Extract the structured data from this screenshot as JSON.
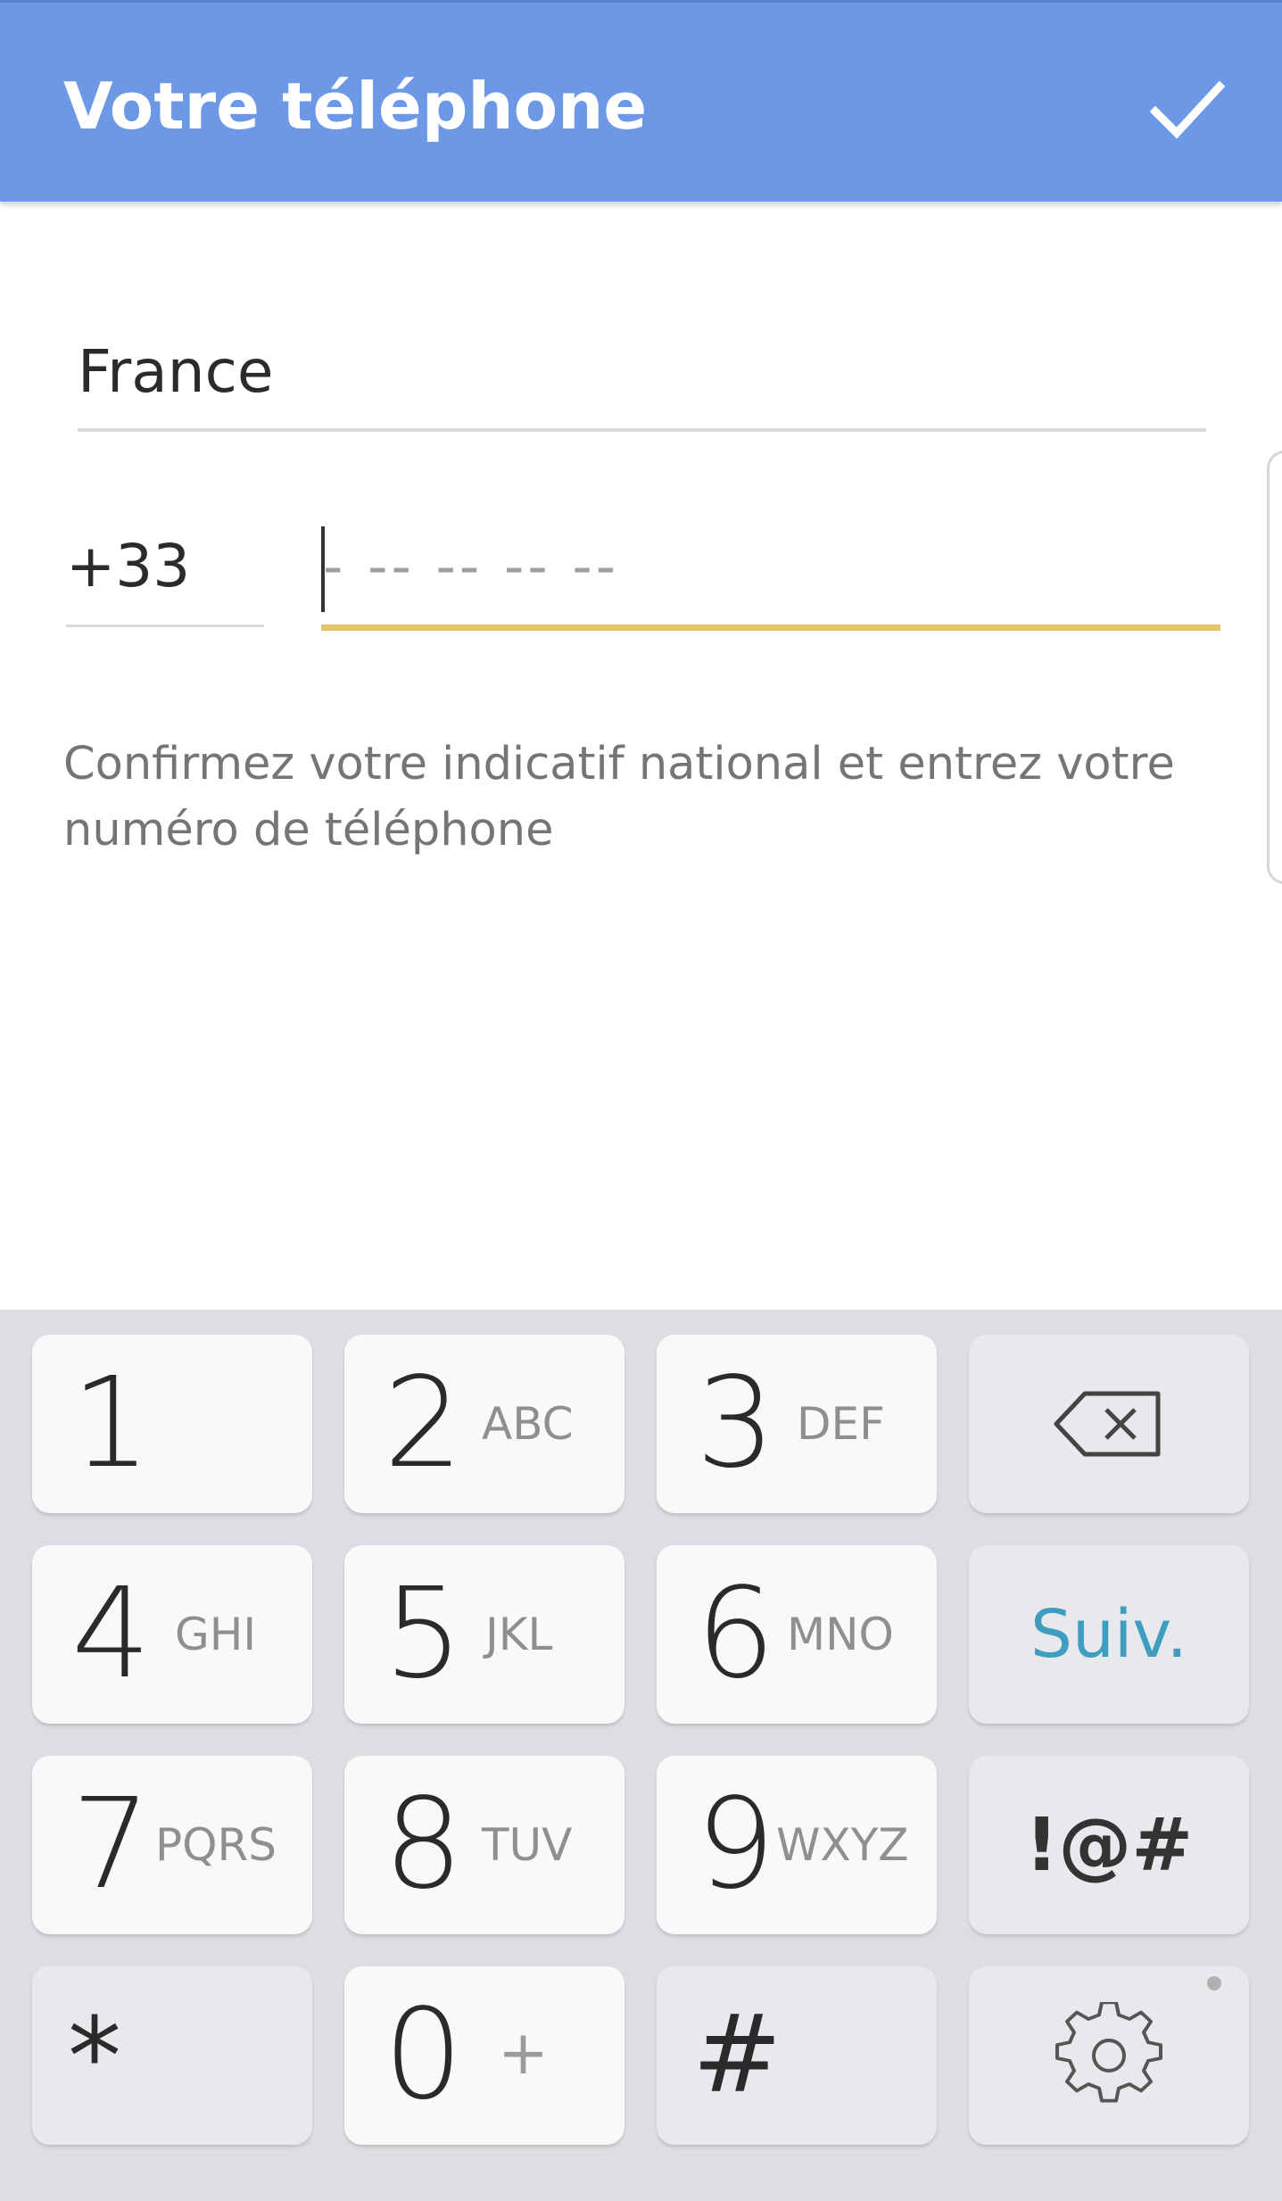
{
  "header": {
    "title": "Votre téléphone",
    "confirm_icon": "check-icon"
  },
  "form": {
    "country": "France",
    "country_code": "+33",
    "phone_placeholder": "- -- -- -- --",
    "phone_value": "",
    "helper_text": "Confirmez votre indicatif national et entrez votre numéro de téléphone"
  },
  "colors": {
    "appbar": "#6c98e5",
    "input_focus": "#e6c66b",
    "next_key": "#3f9ec0"
  },
  "keyboard": {
    "keys": [
      {
        "digit": "1",
        "letters": ""
      },
      {
        "digit": "2",
        "letters": "ABC"
      },
      {
        "digit": "3",
        "letters": "DEF"
      },
      {
        "icon": "backspace-icon"
      },
      {
        "digit": "4",
        "letters": "GHI"
      },
      {
        "digit": "5",
        "letters": "JKL"
      },
      {
        "digit": "6",
        "letters": "MNO"
      },
      {
        "label": "Suiv."
      },
      {
        "digit": "7",
        "letters": "PQRS"
      },
      {
        "digit": "8",
        "letters": "TUV"
      },
      {
        "digit": "9",
        "letters": "WXYZ"
      },
      {
        "label": "!@#"
      },
      {
        "symbol": "*"
      },
      {
        "digit": "0",
        "letters": "+"
      },
      {
        "symbol": "#"
      },
      {
        "icon": "gear-icon"
      }
    ]
  }
}
